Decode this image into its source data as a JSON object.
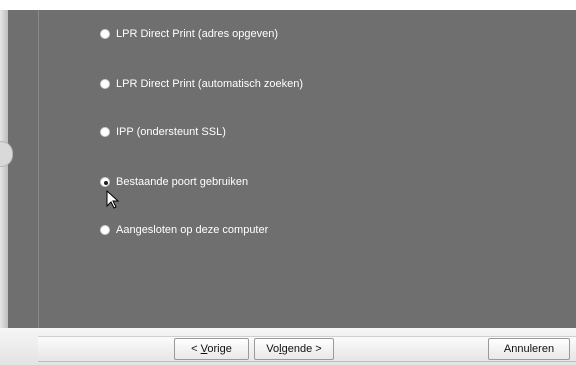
{
  "options": [
    {
      "label": "LPR Direct Print (adres opgeven)",
      "checked": false
    },
    {
      "label": "LPR Direct Print (automatisch zoeken)",
      "checked": false
    },
    {
      "label": "IPP (ondersteunt SSL)",
      "checked": false
    },
    {
      "label": "Bestaande poort gebruiken",
      "checked": true
    },
    {
      "label": "Aangesloten op deze computer",
      "checked": false
    }
  ],
  "buttons": {
    "back_prefix": "< ",
    "back_mnemonic": "V",
    "back_rest": "orige",
    "next_prefix": "Vo",
    "next_mnemonic": "l",
    "next_rest": "gende >",
    "cancel": "Annuleren"
  }
}
